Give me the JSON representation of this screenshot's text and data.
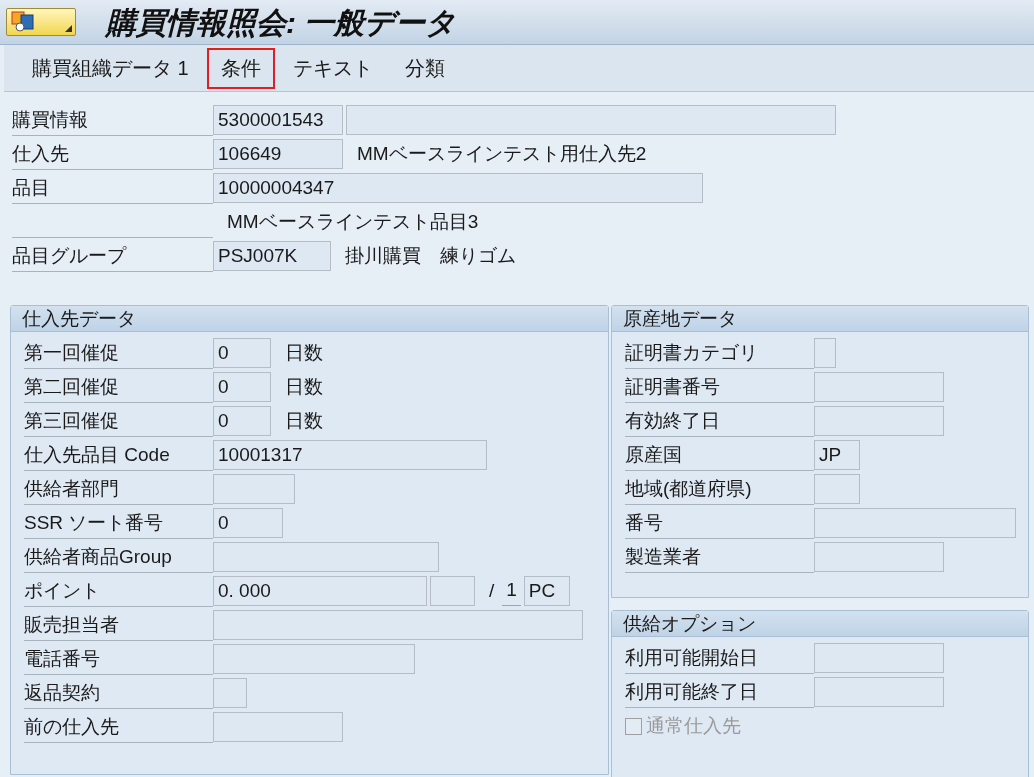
{
  "title": "購買情報照会: 一般データ",
  "tabs": [
    {
      "label": "購買組織データ 1",
      "selected": false
    },
    {
      "label": "条件",
      "selected": true
    },
    {
      "label": "テキスト",
      "selected": false
    },
    {
      "label": "分類",
      "selected": false
    }
  ],
  "header": [
    {
      "label": "購買情報",
      "parts": [
        {
          "kind": "field",
          "value": "5300001543"
        },
        {
          "kind": "field"
        }
      ]
    },
    {
      "label": "仕入先",
      "parts": [
        {
          "kind": "field",
          "value": "106649"
        },
        {
          "kind": "text",
          "text": "MMベースラインテスト用仕入先2"
        }
      ]
    },
    {
      "label": "品目",
      "parts": [
        {
          "kind": "field",
          "value": "10000004347"
        }
      ]
    },
    {
      "parts": [
        {
          "kind": "text",
          "text": "MMベースラインテスト品目3"
        }
      ]
    },
    {
      "label": "品目グループ",
      "parts": [
        {
          "kind": "field",
          "value": "PSJ007K"
        },
        {
          "kind": "text",
          "text": "掛川購買　練りゴム"
        }
      ]
    }
  ],
  "vendor_data": {
    "title": "仕入先データ",
    "rows": [
      {
        "label": "第一回催促",
        "parts": [
          {
            "kind": "field",
            "value": "0"
          },
          {
            "kind": "text",
            "text": "日数"
          }
        ]
      },
      {
        "label": "第二回催促",
        "parts": [
          {
            "kind": "field",
            "value": "0"
          },
          {
            "kind": "text",
            "text": "日数"
          }
        ]
      },
      {
        "label": "第三回催促",
        "parts": [
          {
            "kind": "field",
            "value": "0"
          },
          {
            "kind": "text",
            "text": "日数"
          }
        ]
      },
      {
        "label": "仕入先品目 Code",
        "parts": [
          {
            "kind": "field",
            "value": "10001317"
          }
        ]
      },
      {
        "label": "供給者部門",
        "parts": [
          {
            "kind": "field"
          }
        ]
      },
      {
        "label": "SSR ソート番号",
        "parts": [
          {
            "kind": "field",
            "value": "0"
          }
        ]
      },
      {
        "label": "供給者商品Group",
        "parts": [
          {
            "kind": "field"
          }
        ]
      },
      {
        "label": "ポイント",
        "parts": [
          {
            "kind": "field",
            "value": "0. 000"
          },
          {
            "kind": "field"
          },
          {
            "kind": "text",
            "text": "/"
          },
          {
            "kind": "underlined",
            "text": "1"
          },
          {
            "kind": "field",
            "value": "PC"
          }
        ]
      },
      {
        "label": "販売担当者",
        "parts": [
          {
            "kind": "field"
          }
        ]
      },
      {
        "label": "電話番号",
        "parts": [
          {
            "kind": "field"
          }
        ]
      },
      {
        "label": "返品契約",
        "parts": [
          {
            "kind": "field"
          }
        ]
      },
      {
        "label": "前の仕入先",
        "parts": [
          {
            "kind": "field"
          }
        ]
      }
    ]
  },
  "origin_data": {
    "title": "原産地データ",
    "rows": [
      {
        "label": "証明書カテゴリ",
        "parts": [
          {
            "kind": "field"
          }
        ]
      },
      {
        "label": "証明書番号",
        "parts": [
          {
            "kind": "field"
          }
        ]
      },
      {
        "label": "有効終了日",
        "parts": [
          {
            "kind": "field"
          }
        ]
      },
      {
        "label": "原産国",
        "parts": [
          {
            "kind": "field",
            "value": "JP"
          }
        ]
      },
      {
        "label": "地域(都道府県)",
        "parts": [
          {
            "kind": "field"
          }
        ]
      },
      {
        "label": "番号",
        "parts": [
          {
            "kind": "field"
          }
        ]
      },
      {
        "label": "製造業者",
        "parts": [
          {
            "kind": "field"
          }
        ]
      }
    ]
  },
  "supply_options": {
    "title": "供給オプション",
    "rows": [
      {
        "label": "利用可能開始日",
        "parts": [
          {
            "kind": "field"
          }
        ]
      },
      {
        "label": "利用可能終了日",
        "parts": [
          {
            "kind": "field"
          }
        ]
      }
    ],
    "checkbox": {
      "label": "通常仕入先",
      "checked": false,
      "disabled": true
    }
  }
}
